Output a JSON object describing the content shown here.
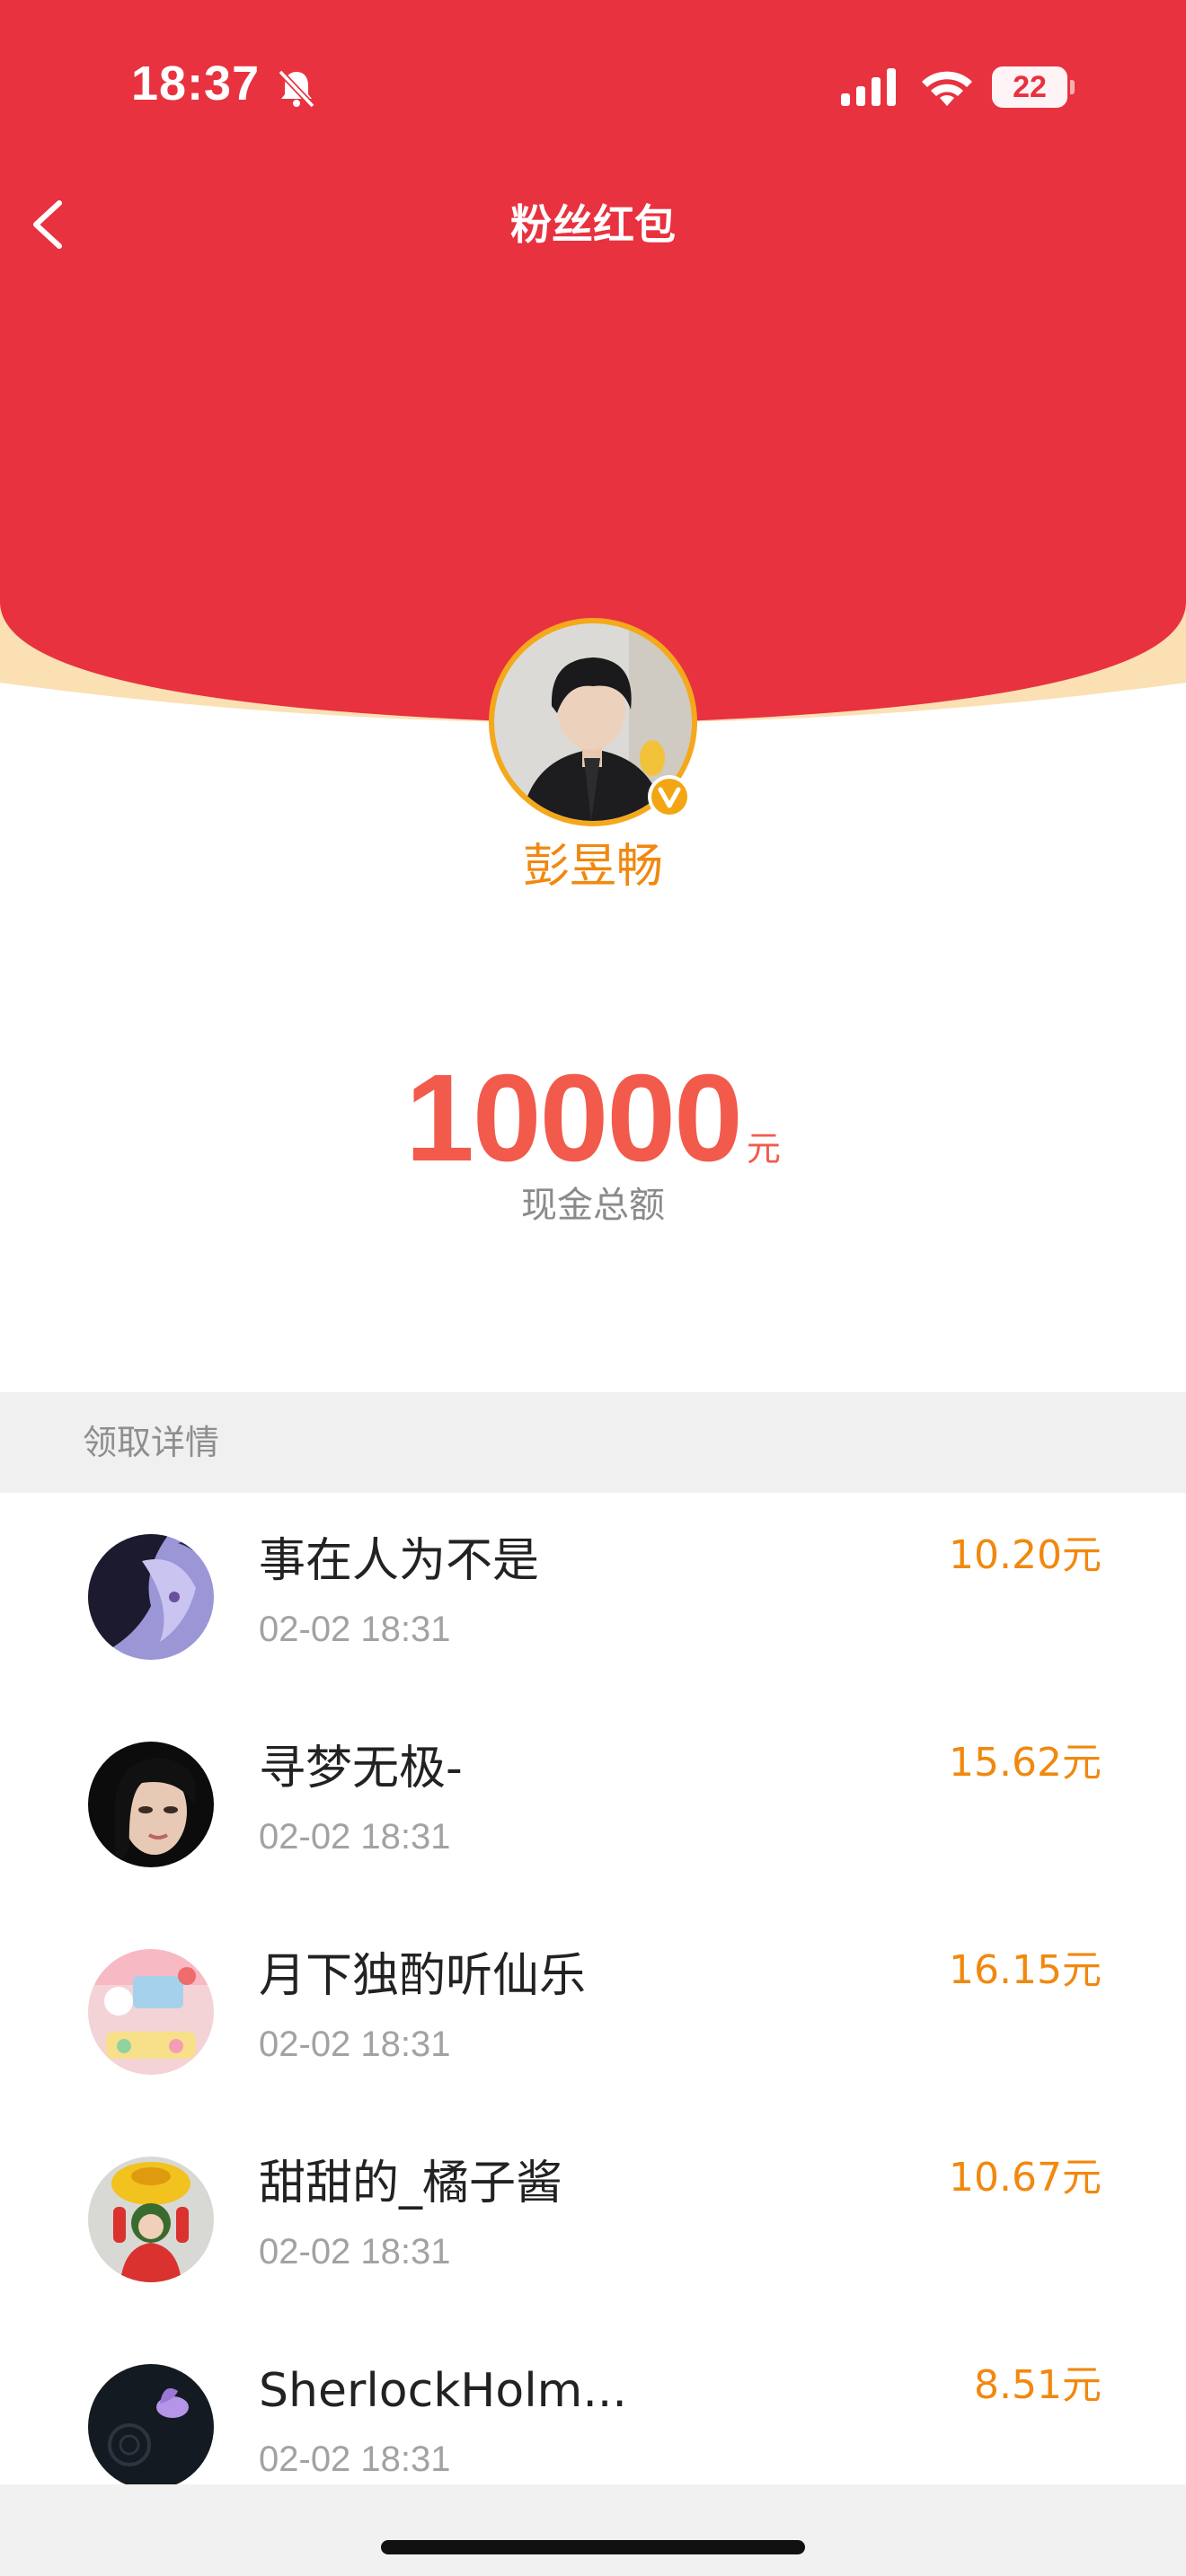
{
  "status_bar": {
    "time": "18:37",
    "battery_level": "22",
    "icons": [
      "mute-bell-icon",
      "cellular-signal-icon",
      "wifi-icon",
      "battery-icon"
    ]
  },
  "nav": {
    "title": "粉丝红包",
    "back_icon": "chevron-left-icon"
  },
  "sender": {
    "name": "彭昱畅",
    "verified_badge": "verified-v-icon"
  },
  "total": {
    "amount": "10000",
    "unit": "元",
    "label": "现金总额"
  },
  "details": {
    "section_title": "领取详情",
    "items": [
      {
        "name": "事在人为不是",
        "time": "02-02 18:31",
        "amount": "10.20元"
      },
      {
        "name": "寻梦无极-",
        "time": "02-02 18:31",
        "amount": "15.62元"
      },
      {
        "name": "月下独酌听仙乐",
        "time": "02-02 18:31",
        "amount": "16.15元"
      },
      {
        "name": "甜甜的_橘子酱",
        "time": "02-02 18:31",
        "amount": "10.67元"
      },
      {
        "name": "SherlockHolm...",
        "time": "02-02 18:31",
        "amount": "8.51元"
      }
    ]
  },
  "colors": {
    "header_red": "#e8323f",
    "header_rim": "#fbe0b4",
    "accent_orange": "#f1880f",
    "amount_red": "#f25a4c"
  }
}
